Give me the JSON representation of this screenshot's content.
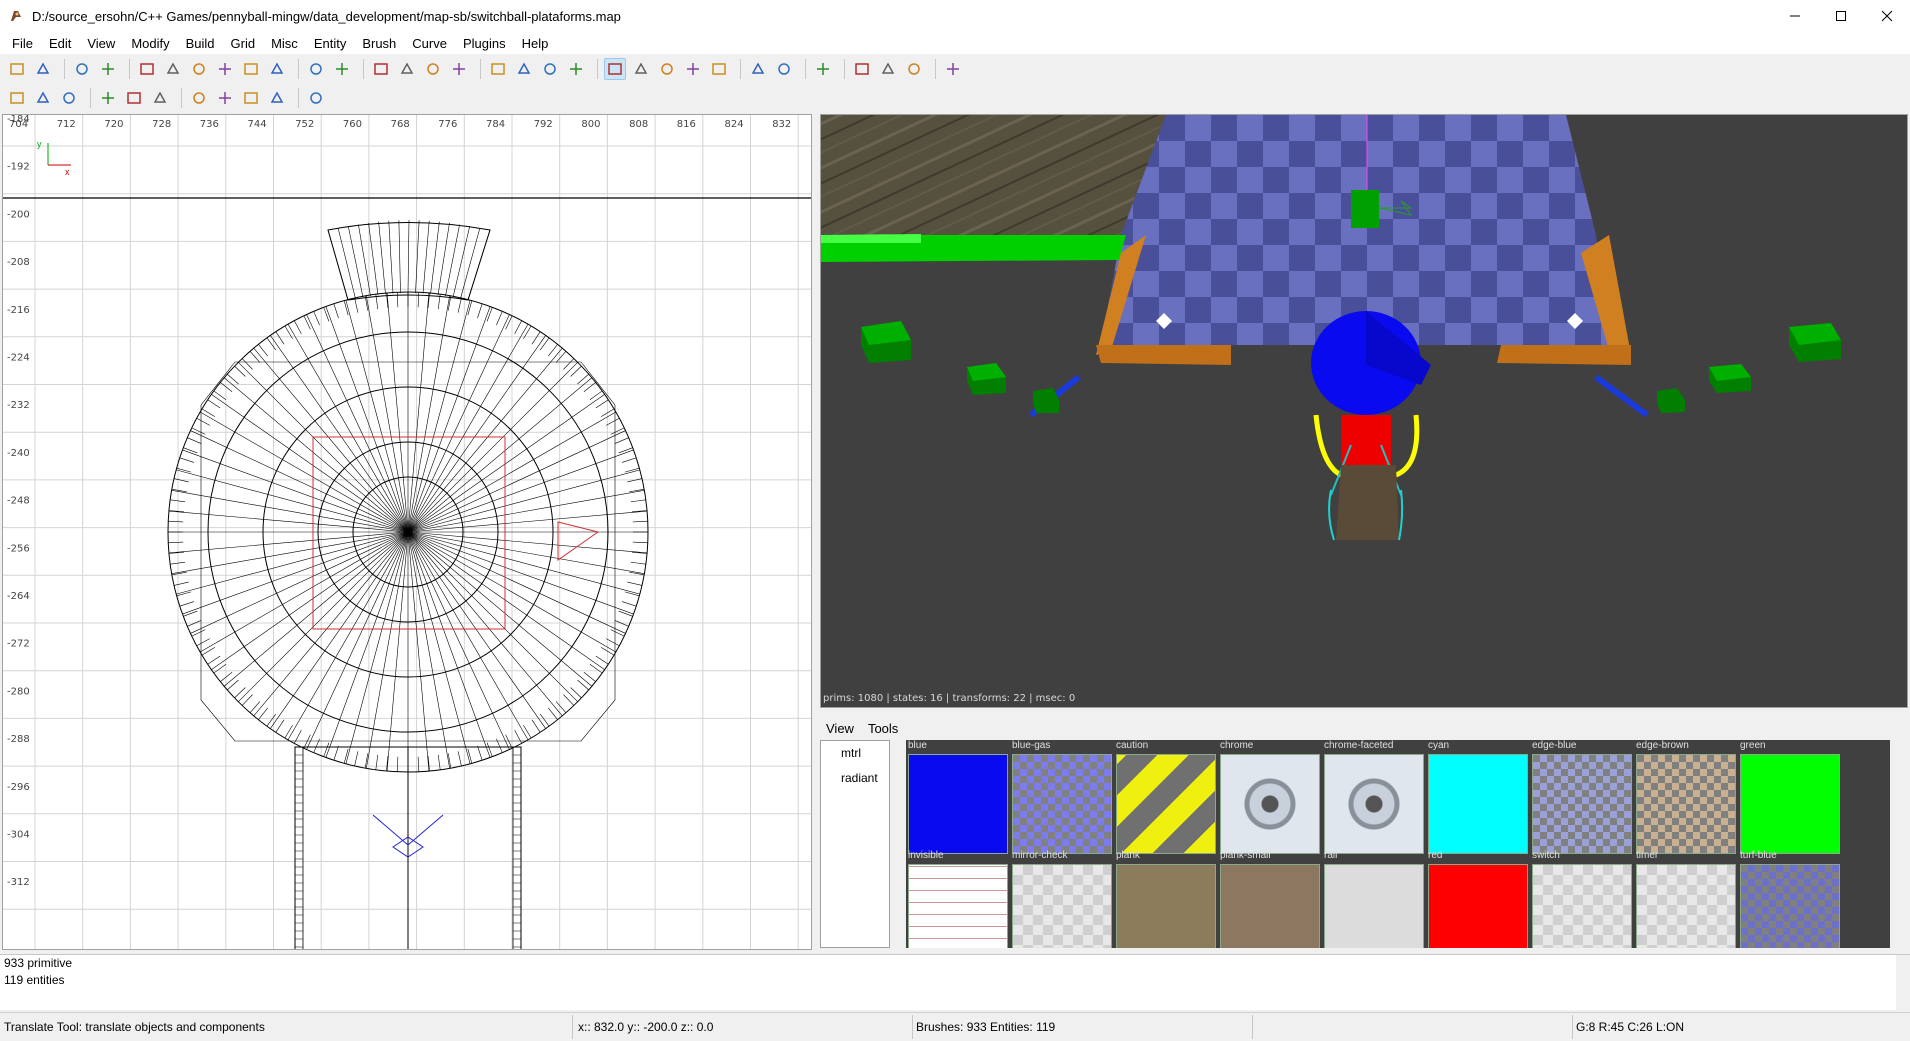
{
  "window": {
    "title": "D:/source_ersohn/C++ Games/pennyball-mingw/data_development/map-sb/switchball-plataforms.map",
    "minimize_icon": "minimize-icon",
    "maximize_icon": "maximize-icon",
    "close_icon": "close-icon"
  },
  "menu": [
    {
      "label": "File"
    },
    {
      "label": "Edit"
    },
    {
      "label": "View"
    },
    {
      "label": "Modify"
    },
    {
      "label": "Build"
    },
    {
      "label": "Grid"
    },
    {
      "label": "Misc"
    },
    {
      "label": "Entity"
    },
    {
      "label": "Brush"
    },
    {
      "label": "Curve"
    },
    {
      "label": "Plugins"
    },
    {
      "label": "Help"
    }
  ],
  "toolbar1": {
    "buttons": [
      "open",
      "save",
      "undo",
      "redo",
      "flip-x",
      "flip-y",
      "flip-z",
      "rotate-x",
      "rotate-y",
      "rotate-z",
      "csg-subtract",
      "csg-merge",
      "view-change",
      "view-clipper",
      "texture-lock",
      "select-inside",
      "brush-3",
      "brush-4",
      "brush-5",
      "scale",
      "translate-tool",
      "rotate-tool",
      "scale-tool",
      "drag-tool",
      "resize-tool",
      "clipper-tool",
      "entity-color",
      "texture-lock-toggle",
      "patch-1",
      "patch-2",
      "patch-3",
      "refresh-models"
    ],
    "active": "translate-tool"
  },
  "toolbar2": {
    "buttons": [
      "refresh",
      "shape",
      "texture",
      "patch-thicken",
      "patch-cap",
      "patch-bend",
      "mirror-x",
      "mirror-y",
      "cap-1",
      "cap-2",
      "filter"
    ]
  },
  "view2d": {
    "x_ticks": [
      "704",
      "712",
      "720",
      "728",
      "736",
      "744",
      "752",
      "760",
      "768",
      "776",
      "784",
      "792",
      "800",
      "808",
      "816",
      "824",
      "832"
    ],
    "y_ticks": [
      "-184",
      "-192",
      "-200",
      "-208",
      "-216",
      "-224",
      "-232",
      "-240",
      "-248",
      "-256",
      "-264",
      "-272",
      "-280",
      "-288",
      "-296",
      "-304",
      "-312"
    ],
    "axis_x_label": "x",
    "axis_y_label": "y"
  },
  "view3d": {
    "stats": "prims: 1080 | states: 16 | transforms: 22 | msec: 0"
  },
  "texture_browser": {
    "menu": [
      "View",
      "Tools"
    ],
    "tree": [
      "mtrl",
      "radiant"
    ],
    "row1": [
      {
        "name": "blue",
        "color": "#0a0af0"
      },
      {
        "name": "blue-gas",
        "color": "#7c7cee"
      },
      {
        "name": "caution",
        "color": "#eeee10"
      },
      {
        "name": "chrome",
        "color": "#c8d0dc"
      },
      {
        "name": "chrome-faceted",
        "color": "#c8d0dc"
      },
      {
        "name": "cyan",
        "color": "#00ffff"
      },
      {
        "name": "edge-blue",
        "color": "#9aa0d8"
      },
      {
        "name": "edge-brown",
        "color": "#c8b090"
      },
      {
        "name": "green",
        "color": "#00ff00"
      }
    ],
    "row2": [
      {
        "name": "invisible",
        "color": "#ffffff"
      },
      {
        "name": "mirror-check",
        "color": "#e8e8e8"
      },
      {
        "name": "plank",
        "color": "#8c7c5c"
      },
      {
        "name": "plank-small",
        "color": "#8c7860"
      },
      {
        "name": "rail",
        "color": "#dcdcdc"
      },
      {
        "name": "red",
        "color": "#ff0000"
      },
      {
        "name": "switch",
        "color": "#d8d8d8"
      },
      {
        "name": "timer",
        "color": "#d8d8d8"
      },
      {
        "name": "turf-blue",
        "color": "#6c70c8"
      }
    ]
  },
  "console": {
    "lines": [
      "933 primitive",
      "119 entities"
    ]
  },
  "status": {
    "tool": "Translate Tool: translate objects and components",
    "coords": "x::  832.0  y::  -200.0  z::   0.0",
    "counts": "Brushes: 933 Entities: 119",
    "grid": "G:8  R:45  C:26  L:ON"
  }
}
